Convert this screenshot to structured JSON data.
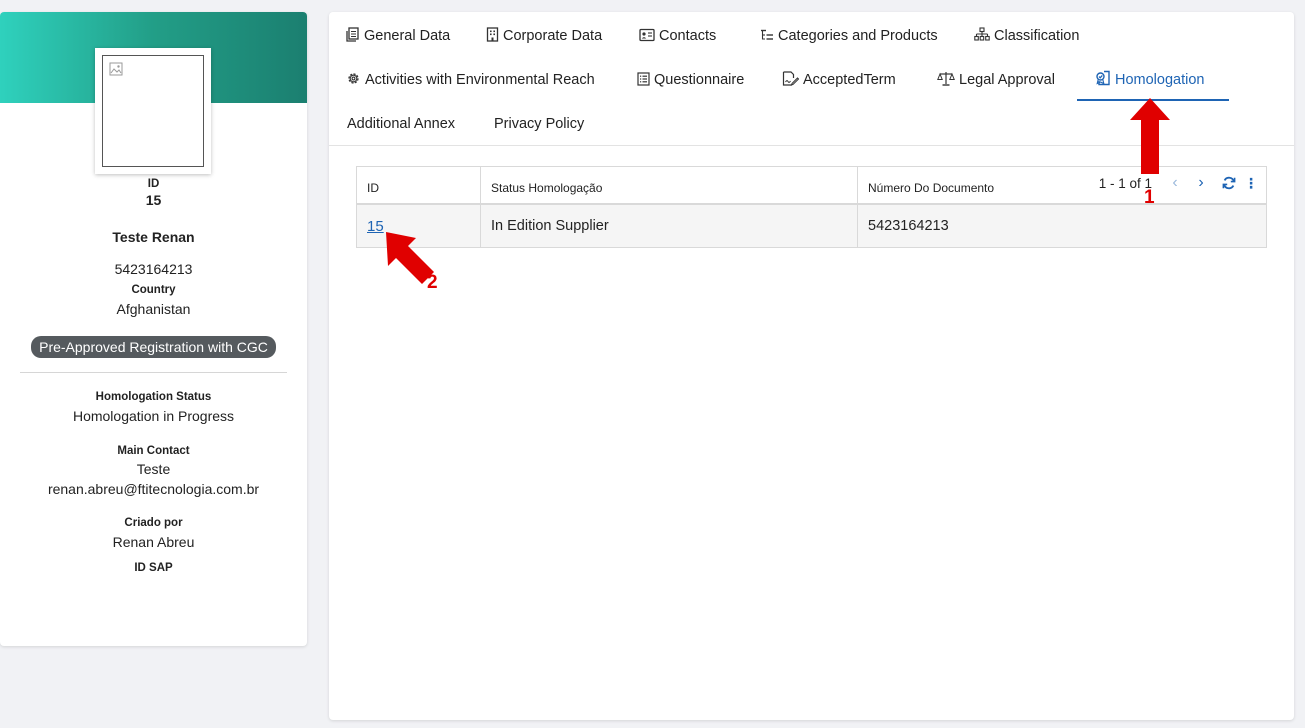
{
  "profile": {
    "id_label": "ID",
    "id_value": "15",
    "name": "Teste Renan",
    "document": "5423164213",
    "country_label": "Country",
    "country_value": "Afghanistan",
    "status_pill": "Pre-Approved Registration with CGC",
    "homologation_status_label": "Homologation Status",
    "homologation_status_value": "Homologation in Progress",
    "main_contact_label": "Main Contact",
    "main_contact_name": "Teste",
    "main_contact_email": "renan.abreu@ftitecnologia.com.br",
    "created_by_label": "Criado por",
    "created_by_value": "Renan Abreu",
    "id_sap_label": "ID SAP"
  },
  "tabs": [
    {
      "label": "General Data",
      "icon": "document-icon"
    },
    {
      "label": "Corporate Data",
      "icon": "building-icon"
    },
    {
      "label": "Contacts",
      "icon": "contact-card-icon"
    },
    {
      "label": "Categories and Products",
      "icon": "tree-list-icon"
    },
    {
      "label": "Classification",
      "icon": "hierarchy-icon"
    },
    {
      "label": "Activities with Environmental Reach",
      "icon": "gear-icon"
    },
    {
      "label": "Questionnaire",
      "icon": "list-icon"
    },
    {
      "label": "AcceptedTerm",
      "icon": "signed-document-icon"
    },
    {
      "label": "Legal Approval",
      "icon": "scales-icon"
    },
    {
      "label": "Homologation",
      "icon": "homologation-icon",
      "active": true
    },
    {
      "label": "Additional Annex"
    },
    {
      "label": "Privacy Policy"
    }
  ],
  "table": {
    "columns": [
      "ID",
      "Status Homologação",
      "Número Do Documento"
    ],
    "rows": [
      {
        "id": "15",
        "status": "In Edition Supplier",
        "document": "5423164213"
      }
    ],
    "pagination": "1 - 1 of 1"
  },
  "annotations": {
    "marker_1": "1",
    "marker_2": "2",
    "color": "#e00000"
  },
  "colors": {
    "accent": "#1e64b4",
    "banner_start": "#2fd1bd",
    "banner_end": "#1b7f70",
    "pill": "#555a5e"
  }
}
